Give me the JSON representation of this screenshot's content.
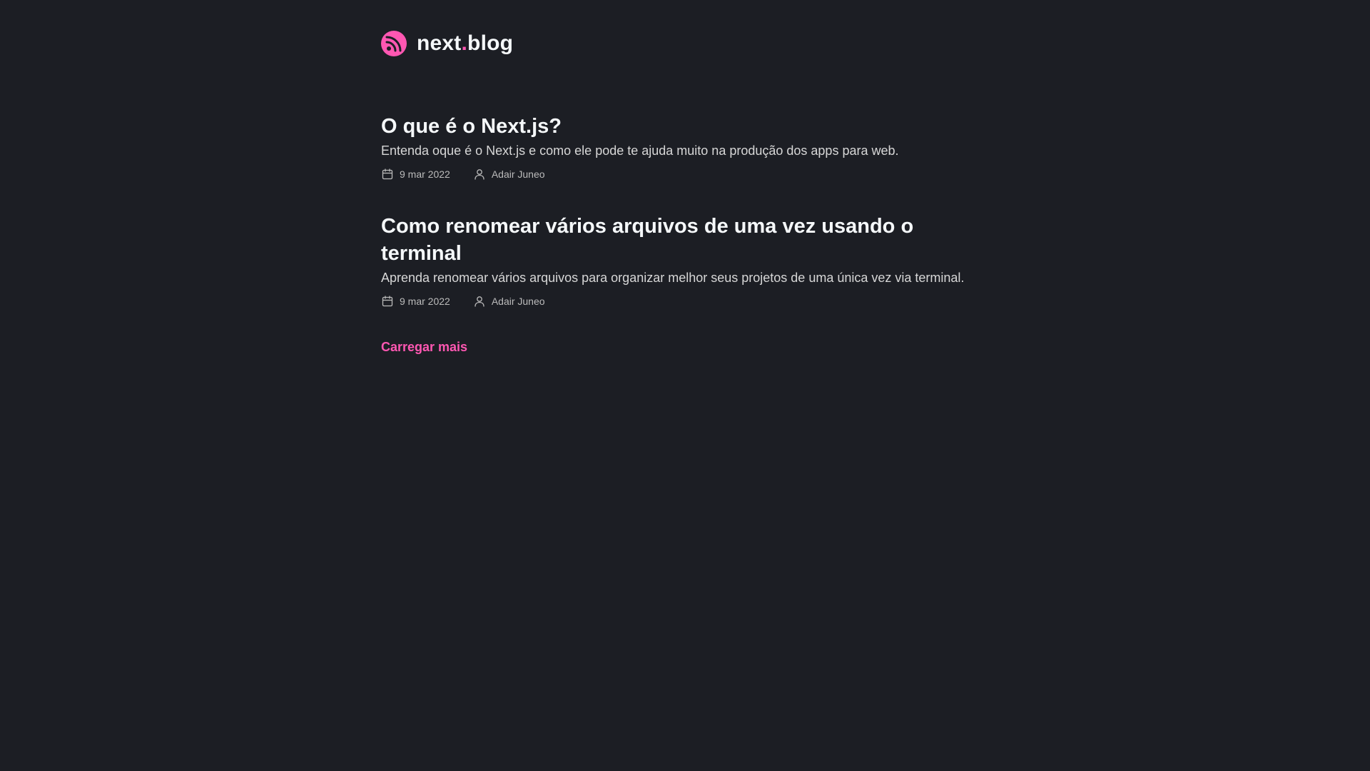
{
  "header": {
    "logo_icon": "rss-icon",
    "brand_part1": "next",
    "brand_dot": ".",
    "brand_part2": "blog",
    "accent_color": "#ff57b2"
  },
  "posts": [
    {
      "title": "O que é o Next.js?",
      "subtitle": "Entenda oque é o Next.js e como ele pode te ajuda muito na produção dos apps para web.",
      "date": "9 mar 2022",
      "author": "Adair Juneo",
      "date_icon": "calendar-icon",
      "author_icon": "user-icon"
    },
    {
      "title": "Como renomear vários arquivos de uma vez usando o terminal",
      "subtitle": "Aprenda renomear vários arquivos para organizar melhor seus projetos de uma única vez via terminal.",
      "date": "9 mar 2022",
      "author": "Adair Juneo",
      "date_icon": "calendar-icon",
      "author_icon": "user-icon"
    }
  ],
  "load_more_label": "Carregar mais",
  "colors": {
    "background": "#1c1e24",
    "text": "#f5f8fa",
    "muted": "#bbbbbb",
    "accent": "#ff57b2"
  }
}
